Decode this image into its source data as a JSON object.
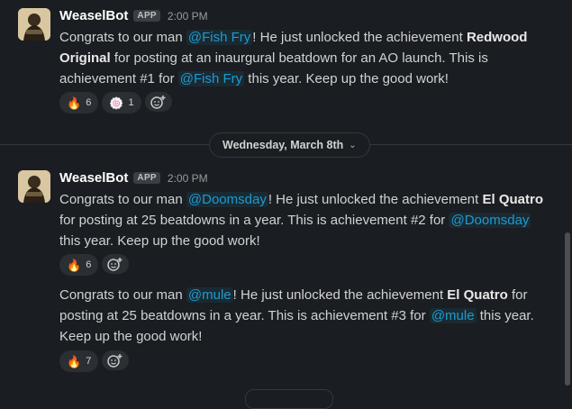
{
  "messages": [
    {
      "author": "WeaselBot",
      "badge": "APP",
      "time": "2:00 PM",
      "segments": [
        {
          "t": "text",
          "v": "Congrats to our man "
        },
        {
          "t": "mention",
          "v": "@Fish Fry"
        },
        {
          "t": "text",
          "v": "! He just unlocked the achievement "
        },
        {
          "t": "bold",
          "v": "Redwood Original"
        },
        {
          "t": "text",
          "v": " for posting at an inaurgural beatdown for an AO launch. This is achievement #1 for "
        },
        {
          "t": "mention",
          "v": "@Fish Fry"
        },
        {
          "t": "text",
          "v": " this year. Keep up the good work!"
        }
      ],
      "reactions": [
        {
          "emoji": "🔥",
          "count": "6"
        },
        {
          "emoji": "🍥",
          "count": "1"
        }
      ]
    },
    {
      "author": "WeaselBot",
      "badge": "APP",
      "time": "2:00 PM",
      "segments": [
        {
          "t": "text",
          "v": "Congrats to our man "
        },
        {
          "t": "mention",
          "v": "@Doomsday"
        },
        {
          "t": "text",
          "v": "! He just unlocked the achievement "
        },
        {
          "t": "bold",
          "v": "El Quatro"
        },
        {
          "t": "text",
          "v": " for posting at 25 beatdowns in a year. This is achievement #2 for "
        },
        {
          "t": "mention",
          "v": "@Doomsday"
        },
        {
          "t": "text",
          "v": " this year. Keep up the good work!"
        }
      ],
      "reactions": [
        {
          "emoji": "🔥",
          "count": "6"
        }
      ]
    },
    {
      "segments": [
        {
          "t": "text",
          "v": "Congrats to our man "
        },
        {
          "t": "mention",
          "v": "@mule"
        },
        {
          "t": "text",
          "v": "! He just unlocked the achievement "
        },
        {
          "t": "bold",
          "v": "El Quatro"
        },
        {
          "t": "text",
          "v": " for posting at 25 beatdowns in a year. This is achievement #3 for "
        },
        {
          "t": "mention",
          "v": "@mule"
        },
        {
          "t": "text",
          "v": " this year. Keep up the good work!"
        }
      ],
      "reactions": [
        {
          "emoji": "🔥",
          "count": "7"
        }
      ]
    }
  ],
  "date_divider": {
    "label": "Wednesday, March 8th"
  },
  "icons": {
    "add_reaction": "add-reaction-icon",
    "chevron": "chevron-down-icon"
  },
  "colors": {
    "background": "#1a1d21",
    "mention": "#1d9bd1",
    "text": "#d1d2d3"
  }
}
